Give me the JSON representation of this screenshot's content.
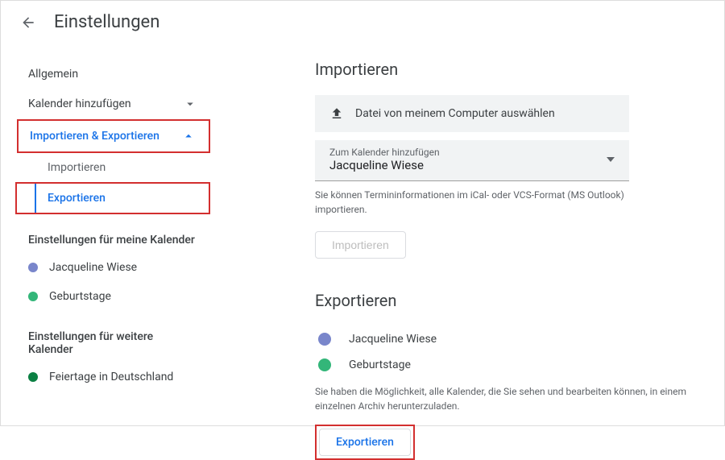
{
  "header": {
    "title": "Einstellungen"
  },
  "sidebar": {
    "general": "Allgemein",
    "add_calendar": "Kalender hinzufügen",
    "import_export": "Importieren & Exportieren",
    "sub_import": "Importieren",
    "sub_export": "Exportieren",
    "my_calendars_heading": "Einstellungen für meine Kalender",
    "cal_personal": {
      "label": "Jacqueline Wiese",
      "color": "#7986cb"
    },
    "cal_birthdays": {
      "label": "Geburtstage",
      "color": "#33b679"
    },
    "other_calendars_heading": "Einstellungen für weitere Kalender",
    "cal_holidays": {
      "label": "Feiertage in Deutschland",
      "color": "#0b8043"
    }
  },
  "main": {
    "import": {
      "title": "Importieren",
      "file_button": "Datei von meinem Computer auswählen",
      "dropdown_label": "Zum Kalender hinzufügen",
      "dropdown_value": "Jacqueline Wiese",
      "helper": "Sie können Termininformationen im iCal- oder VCS-Format (MS Outlook) importieren.",
      "import_button": "Importieren"
    },
    "export": {
      "title": "Exportieren",
      "cal1": {
        "label": "Jacqueline Wiese",
        "color": "#7986cb"
      },
      "cal2": {
        "label": "Geburtstage",
        "color": "#33b679"
      },
      "helper": "Sie haben die Möglichkeit, alle Kalender, die Sie sehen und bearbeiten können, in einem einzelnen Archiv herunterzuladen.",
      "export_button": "Exportieren"
    }
  }
}
